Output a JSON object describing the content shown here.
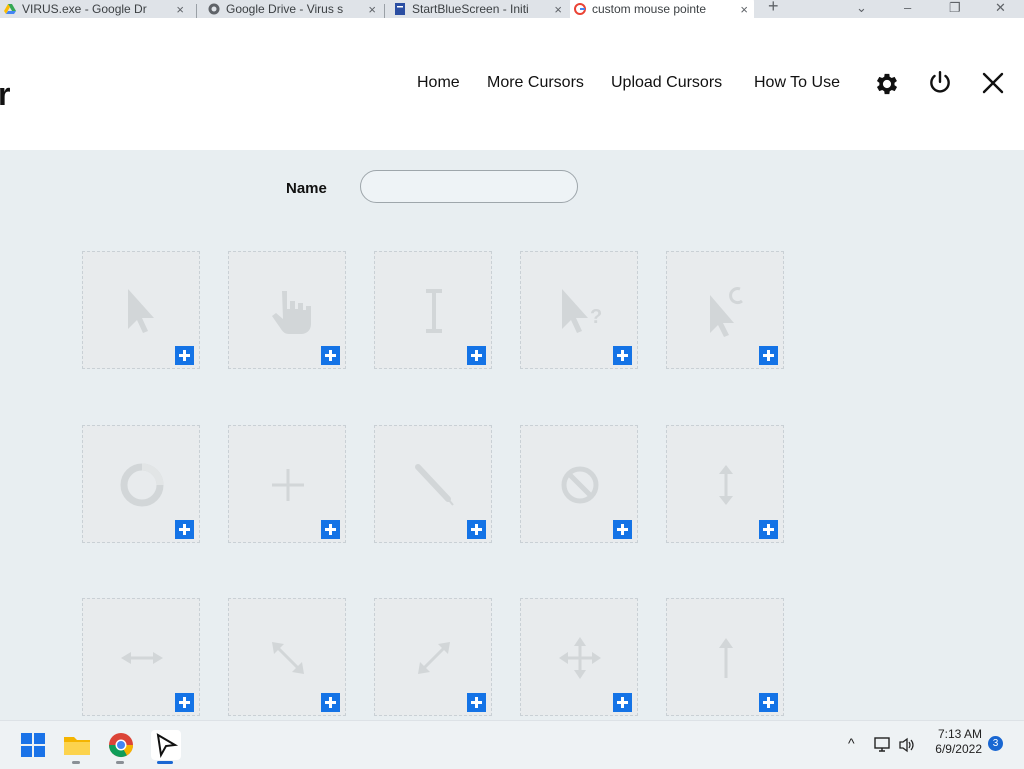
{
  "browser": {
    "tabs": [
      {
        "title": "VIRUS.exe - Google Dr"
      },
      {
        "title": "Google Drive - Virus s"
      },
      {
        "title": "StartBlueScreen - Initi"
      },
      {
        "title": "custom mouse pointe"
      }
    ],
    "new_tab": "+",
    "tab_close": "×"
  },
  "app": {
    "brand_fragment": "r",
    "nav": [
      "Home",
      "More Cursors",
      "Upload Cursors",
      "How To Use"
    ],
    "icons": {
      "settings": "gear-icon",
      "power": "power-icon",
      "close": "close-icon"
    }
  },
  "form": {
    "name_label": "Name",
    "name_value": ""
  },
  "slots": [
    {
      "icon": "arrow-pointer-icon"
    },
    {
      "icon": "hand-pointer-icon"
    },
    {
      "icon": "text-beam-icon"
    },
    {
      "icon": "help-select-icon"
    },
    {
      "icon": "working-in-background-icon"
    },
    {
      "icon": "busy-icon"
    },
    {
      "icon": "precision-select-icon"
    },
    {
      "icon": "handwriting-icon"
    },
    {
      "icon": "unavailable-icon"
    },
    {
      "icon": "vertical-resize-icon"
    },
    {
      "icon": "horizontal-resize-icon"
    },
    {
      "icon": "diagonal-resize-1-icon"
    },
    {
      "icon": "diagonal-resize-2-icon"
    },
    {
      "icon": "move-icon"
    },
    {
      "icon": "alternate-select-icon"
    }
  ],
  "taskbar": {
    "apps": [
      "start-icon",
      "file-explorer-icon",
      "chrome-icon",
      "custom-cursor-app-icon"
    ],
    "clock_time": "7:13 AM",
    "clock_date": "6/9/2022",
    "notification_count": "3"
  },
  "colors": {
    "accent": "#1473e6",
    "page_bg": "#e8eef1",
    "glyph": "#d2d6d8"
  }
}
